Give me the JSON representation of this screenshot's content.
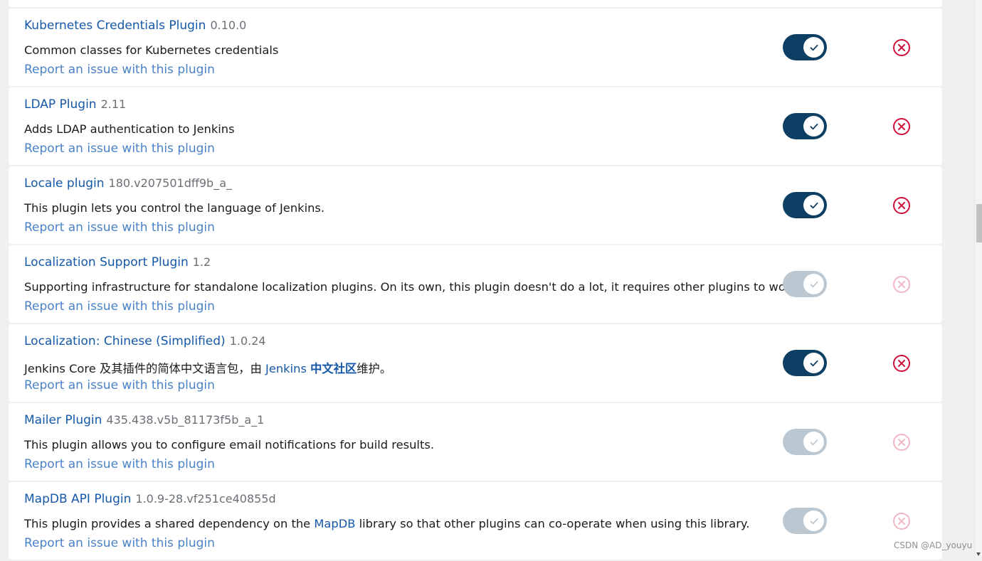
{
  "report_label": "Report an issue with this plugin",
  "plugins": [
    {
      "name": "Kubernetes Credentials Plugin",
      "version": "0.10.0",
      "description": "Common classes for Kubernetes credentials",
      "enabled": true,
      "uninstall_enabled": true
    },
    {
      "name": "LDAP Plugin",
      "version": "2.11",
      "description": "Adds LDAP authentication to Jenkins",
      "enabled": true,
      "uninstall_enabled": true
    },
    {
      "name": "Locale plugin",
      "version": "180.v207501dff9b_a_",
      "description": "This plugin lets you control the language of Jenkins.",
      "enabled": true,
      "uninstall_enabled": true
    },
    {
      "name": "Localization Support Plugin",
      "version": "1.2",
      "description": "Supporting infrastructure for standalone localization plugins. On its own, this plugin doesn't do a lot, it requires other plugins to work.",
      "enabled": false,
      "uninstall_enabled": false
    },
    {
      "name": "Localization: Chinese (Simplified)",
      "version": "1.0.24",
      "description_before": "Jenkins Core 及其插件的简体中文语言包，由 ",
      "description_link_text": "Jenkins ",
      "description_link_bold": "中文社区",
      "description_after": "维护。",
      "enabled": true,
      "uninstall_enabled": true
    },
    {
      "name": "Mailer Plugin",
      "version": "435.438.v5b_81173f5b_a_1",
      "description": "This plugin allows you to configure email notifications for build results.",
      "enabled": false,
      "uninstall_enabled": false
    },
    {
      "name": "MapDB API Plugin",
      "version": "1.0.9-28.vf251ce40855d",
      "description_before": "This plugin provides a shared dependency on the ",
      "description_link_text": "MapDB",
      "description_after": " library so that other plugins can co-operate when using this library.",
      "enabled": false,
      "uninstall_enabled": false
    }
  ],
  "colors": {
    "link": "#1558a8",
    "report_link": "#4a82c8",
    "toggle_on": "#0d3e64",
    "toggle_off": "#bcc8d1",
    "uninstall": "#d0103a"
  },
  "icons": {
    "toggle_knob": "check-icon",
    "uninstall": "circle-x-icon"
  },
  "watermark": "CSDN @AD_youyu"
}
